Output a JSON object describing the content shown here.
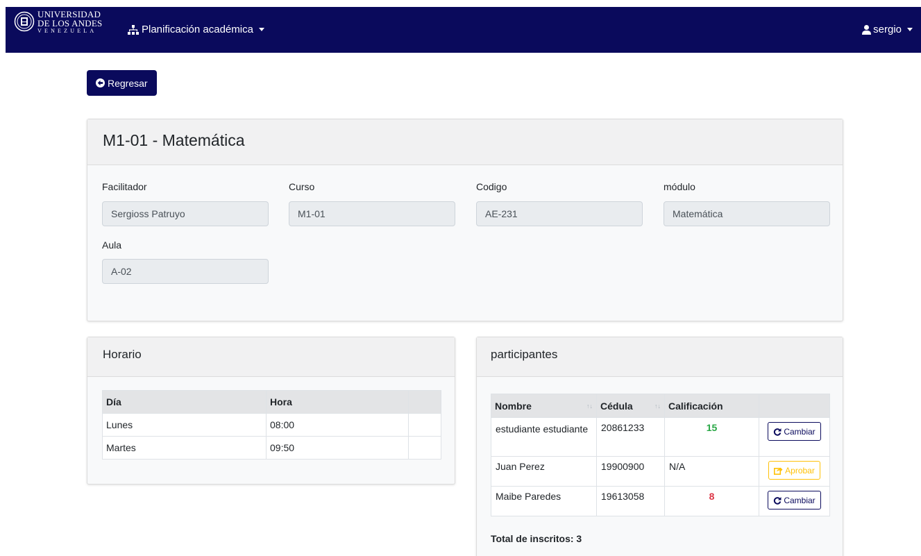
{
  "navbar": {
    "brand_line1": "UNIVERSIDAD",
    "brand_line2": "DE LOS ANDES",
    "brand_line3": "VENEZUELA",
    "menu_label": "Planificación académica",
    "menu_icon": "sitemap-icon",
    "user_label": "sergio",
    "user_icon": "user-icon",
    "bg_color": "#0a0a5c"
  },
  "back_button": {
    "label": "Regresar",
    "icon": "arrow-circle-left-icon"
  },
  "course": {
    "title": "M1-01 - Matemática",
    "fields": {
      "facilitador_label": "Facilitador",
      "facilitador_value": "Sergioss Patruyo",
      "curso_label": "Curso",
      "curso_value": "M1-01",
      "codigo_label": "Codigo",
      "codigo_value": "AE-231",
      "modulo_label": "módulo",
      "modulo_value": "Matemática",
      "aula_label": "Aula",
      "aula_value": "A-02"
    }
  },
  "horario": {
    "title": "Horario",
    "headers": [
      "Día",
      "Hora",
      ""
    ],
    "rows": [
      {
        "dia": "Lunes",
        "hora": "08:00"
      },
      {
        "dia": "Martes",
        "hora": "09:50"
      }
    ]
  },
  "participantes": {
    "title": "participantes",
    "headers": [
      "Nombre",
      "Cédula",
      "Calificación",
      ""
    ],
    "rows": [
      {
        "nombre": "estudiante estudiante",
        "cedula": "20861233",
        "calificacion": "15",
        "accion": "Cambiar"
      },
      {
        "nombre": "Juan Perez",
        "cedula": "19900900",
        "calificacion": "N/A",
        "accion": "Aprobar"
      },
      {
        "nombre": "Maibe Paredes",
        "cedula": "19613058",
        "calificacion": "8",
        "accion": "Cambiar"
      }
    ],
    "total": "Total de inscritos: 3"
  }
}
